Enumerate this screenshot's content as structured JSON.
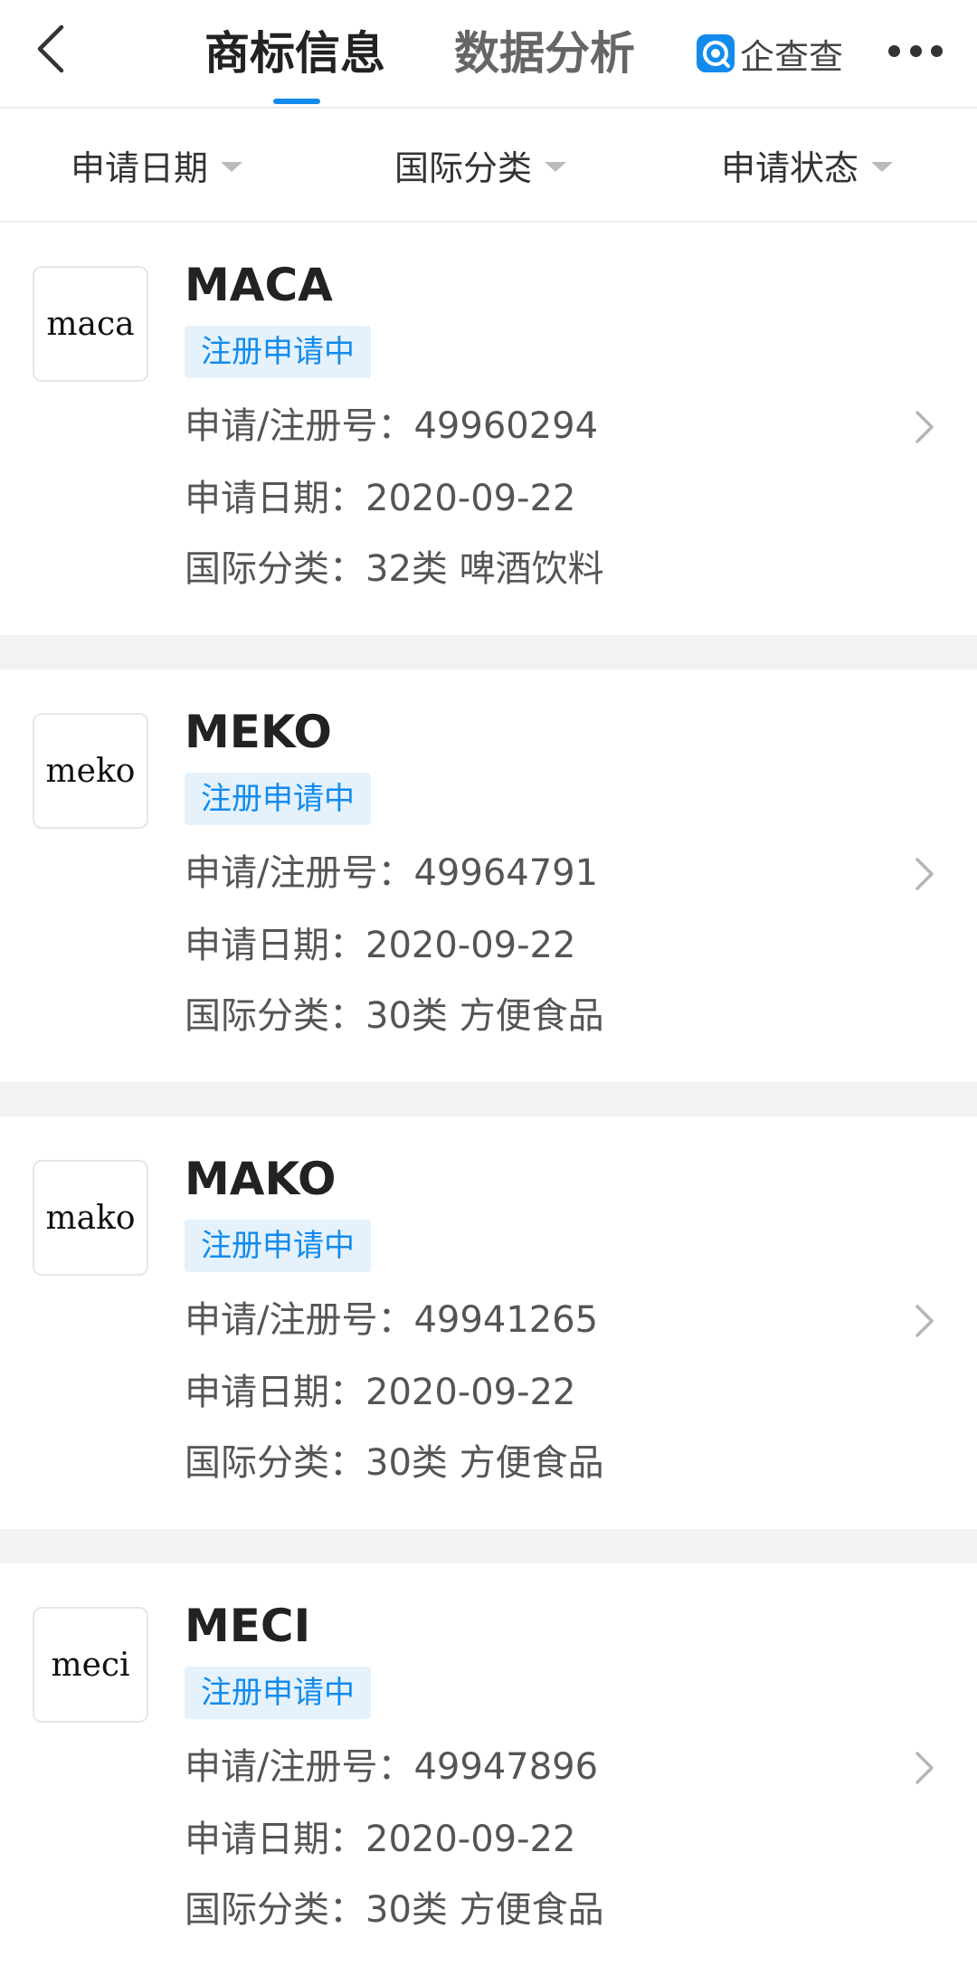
{
  "header": {
    "tabs": [
      {
        "label": "商标信息",
        "active": true
      },
      {
        "label": "数据分析",
        "active": false
      }
    ],
    "brand": "企查查",
    "accent_color": "#128bed"
  },
  "filters": [
    {
      "label": "申请日期"
    },
    {
      "label": "国际分类"
    },
    {
      "label": "申请状态"
    }
  ],
  "trademarks": [
    {
      "logo_text": "maca",
      "name": "MACA",
      "status": "注册申请中",
      "reg_no": "申请/注册号：49960294",
      "date": "申请日期：2020-09-22",
      "category": "国际分类：32类 啤酒饮料"
    },
    {
      "logo_text": "meko",
      "name": "MEKO",
      "status": "注册申请中",
      "reg_no": "申请/注册号：49964791",
      "date": "申请日期：2020-09-22",
      "category": "国际分类：30类 方便食品"
    },
    {
      "logo_text": "mako",
      "name": "MAKO",
      "status": "注册申请中",
      "reg_no": "申请/注册号：49941265",
      "date": "申请日期：2020-09-22",
      "category": "国际分类：30类 方便食品"
    },
    {
      "logo_text": "meci",
      "name": "MECI",
      "status": "注册申请中",
      "reg_no": "申请/注册号：49947896",
      "date": "申请日期：2020-09-22",
      "category": "国际分类：30类 方便食品"
    }
  ]
}
